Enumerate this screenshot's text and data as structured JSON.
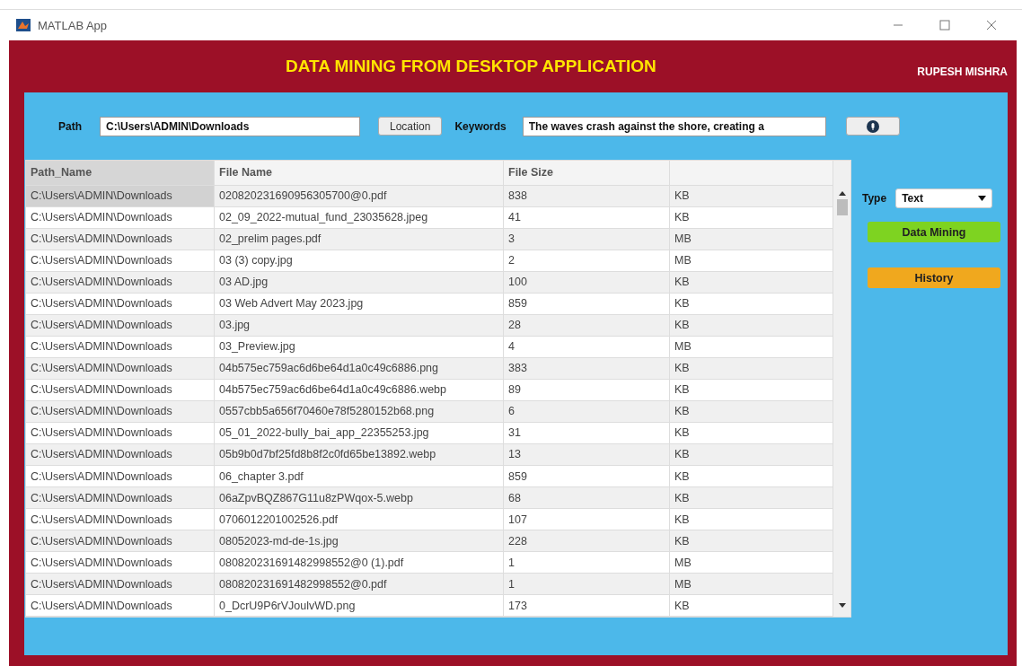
{
  "window": {
    "title": "MATLAB App"
  },
  "header": {
    "title": "DATA MINING FROM DESKTOP APPLICATION",
    "author": "RUPESH MISHRA"
  },
  "toolbar": {
    "path_label": "Path",
    "path_value": "C:\\Users\\ADMIN\\Downloads",
    "location_button": "Location",
    "keywords_label": "Keywords",
    "keywords_value": "The waves crash against the shore, creating a"
  },
  "table": {
    "columns": [
      "Path_Name",
      "File Name",
      "File Size"
    ],
    "rows": [
      {
        "path": "C:\\Users\\ADMIN\\Downloads",
        "name": "020820231690956305700@0.pdf",
        "size": "838",
        "unit": "KB",
        "selected": true
      },
      {
        "path": "C:\\Users\\ADMIN\\Downloads",
        "name": "02_09_2022-mutual_fund_23035628.jpeg",
        "size": "41",
        "unit": "KB",
        "selected": false
      },
      {
        "path": "C:\\Users\\ADMIN\\Downloads",
        "name": "02_prelim pages.pdf",
        "size": "3",
        "unit": "MB",
        "selected": false
      },
      {
        "path": "C:\\Users\\ADMIN\\Downloads",
        "name": "03 (3) copy.jpg",
        "size": "2",
        "unit": "MB",
        "selected": false
      },
      {
        "path": "C:\\Users\\ADMIN\\Downloads",
        "name": "03 AD.jpg",
        "size": "100",
        "unit": "KB",
        "selected": false
      },
      {
        "path": "C:\\Users\\ADMIN\\Downloads",
        "name": "03 Web Advert May 2023.jpg",
        "size": "859",
        "unit": "KB",
        "selected": false
      },
      {
        "path": "C:\\Users\\ADMIN\\Downloads",
        "name": "03.jpg",
        "size": "28",
        "unit": "KB",
        "selected": false
      },
      {
        "path": "C:\\Users\\ADMIN\\Downloads",
        "name": "03_Preview.jpg",
        "size": "4",
        "unit": "MB",
        "selected": false
      },
      {
        "path": "C:\\Users\\ADMIN\\Downloads",
        "name": "04b575ec759ac6d6be64d1a0c49c6886.png",
        "size": "383",
        "unit": "KB",
        "selected": false
      },
      {
        "path": "C:\\Users\\ADMIN\\Downloads",
        "name": "04b575ec759ac6d6be64d1a0c49c6886.webp",
        "size": "89",
        "unit": "KB",
        "selected": false
      },
      {
        "path": "C:\\Users\\ADMIN\\Downloads",
        "name": "0557cbb5a656f70460e78f5280152b68.png",
        "size": "6",
        "unit": "KB",
        "selected": false
      },
      {
        "path": "C:\\Users\\ADMIN\\Downloads",
        "name": "05_01_2022-bully_bai_app_22355253.jpg",
        "size": "31",
        "unit": "KB",
        "selected": false
      },
      {
        "path": "C:\\Users\\ADMIN\\Downloads",
        "name": "05b9b0d7bf25fd8b8f2c0fd65be13892.webp",
        "size": "13",
        "unit": "KB",
        "selected": false
      },
      {
        "path": "C:\\Users\\ADMIN\\Downloads",
        "name": "06_chapter 3.pdf",
        "size": "859",
        "unit": "KB",
        "selected": false
      },
      {
        "path": "C:\\Users\\ADMIN\\Downloads",
        "name": "06aZpvBQZ867G11u8zPWqox-5.webp",
        "size": "68",
        "unit": "KB",
        "selected": false
      },
      {
        "path": "C:\\Users\\ADMIN\\Downloads",
        "name": "0706012201002526.pdf",
        "size": "107",
        "unit": "KB",
        "selected": false
      },
      {
        "path": "C:\\Users\\ADMIN\\Downloads",
        "name": "08052023-md-de-1s.jpg",
        "size": "228",
        "unit": "KB",
        "selected": false
      },
      {
        "path": "C:\\Users\\ADMIN\\Downloads",
        "name": "080820231691482998552@0 (1).pdf",
        "size": "1",
        "unit": "MB",
        "selected": false
      },
      {
        "path": "C:\\Users\\ADMIN\\Downloads",
        "name": "080820231691482998552@0.pdf",
        "size": "1",
        "unit": "MB",
        "selected": false
      },
      {
        "path": "C:\\Users\\ADMIN\\Downloads",
        "name": "0_DcrU9P6rVJoulvWD.png",
        "size": "173",
        "unit": "KB",
        "selected": false
      }
    ]
  },
  "side": {
    "type_label": "Type",
    "type_value": "Text",
    "buttons": [
      {
        "label": "Data Mining",
        "color": "#7ed321"
      },
      {
        "label": "History",
        "color": "#f0a81e"
      }
    ]
  }
}
